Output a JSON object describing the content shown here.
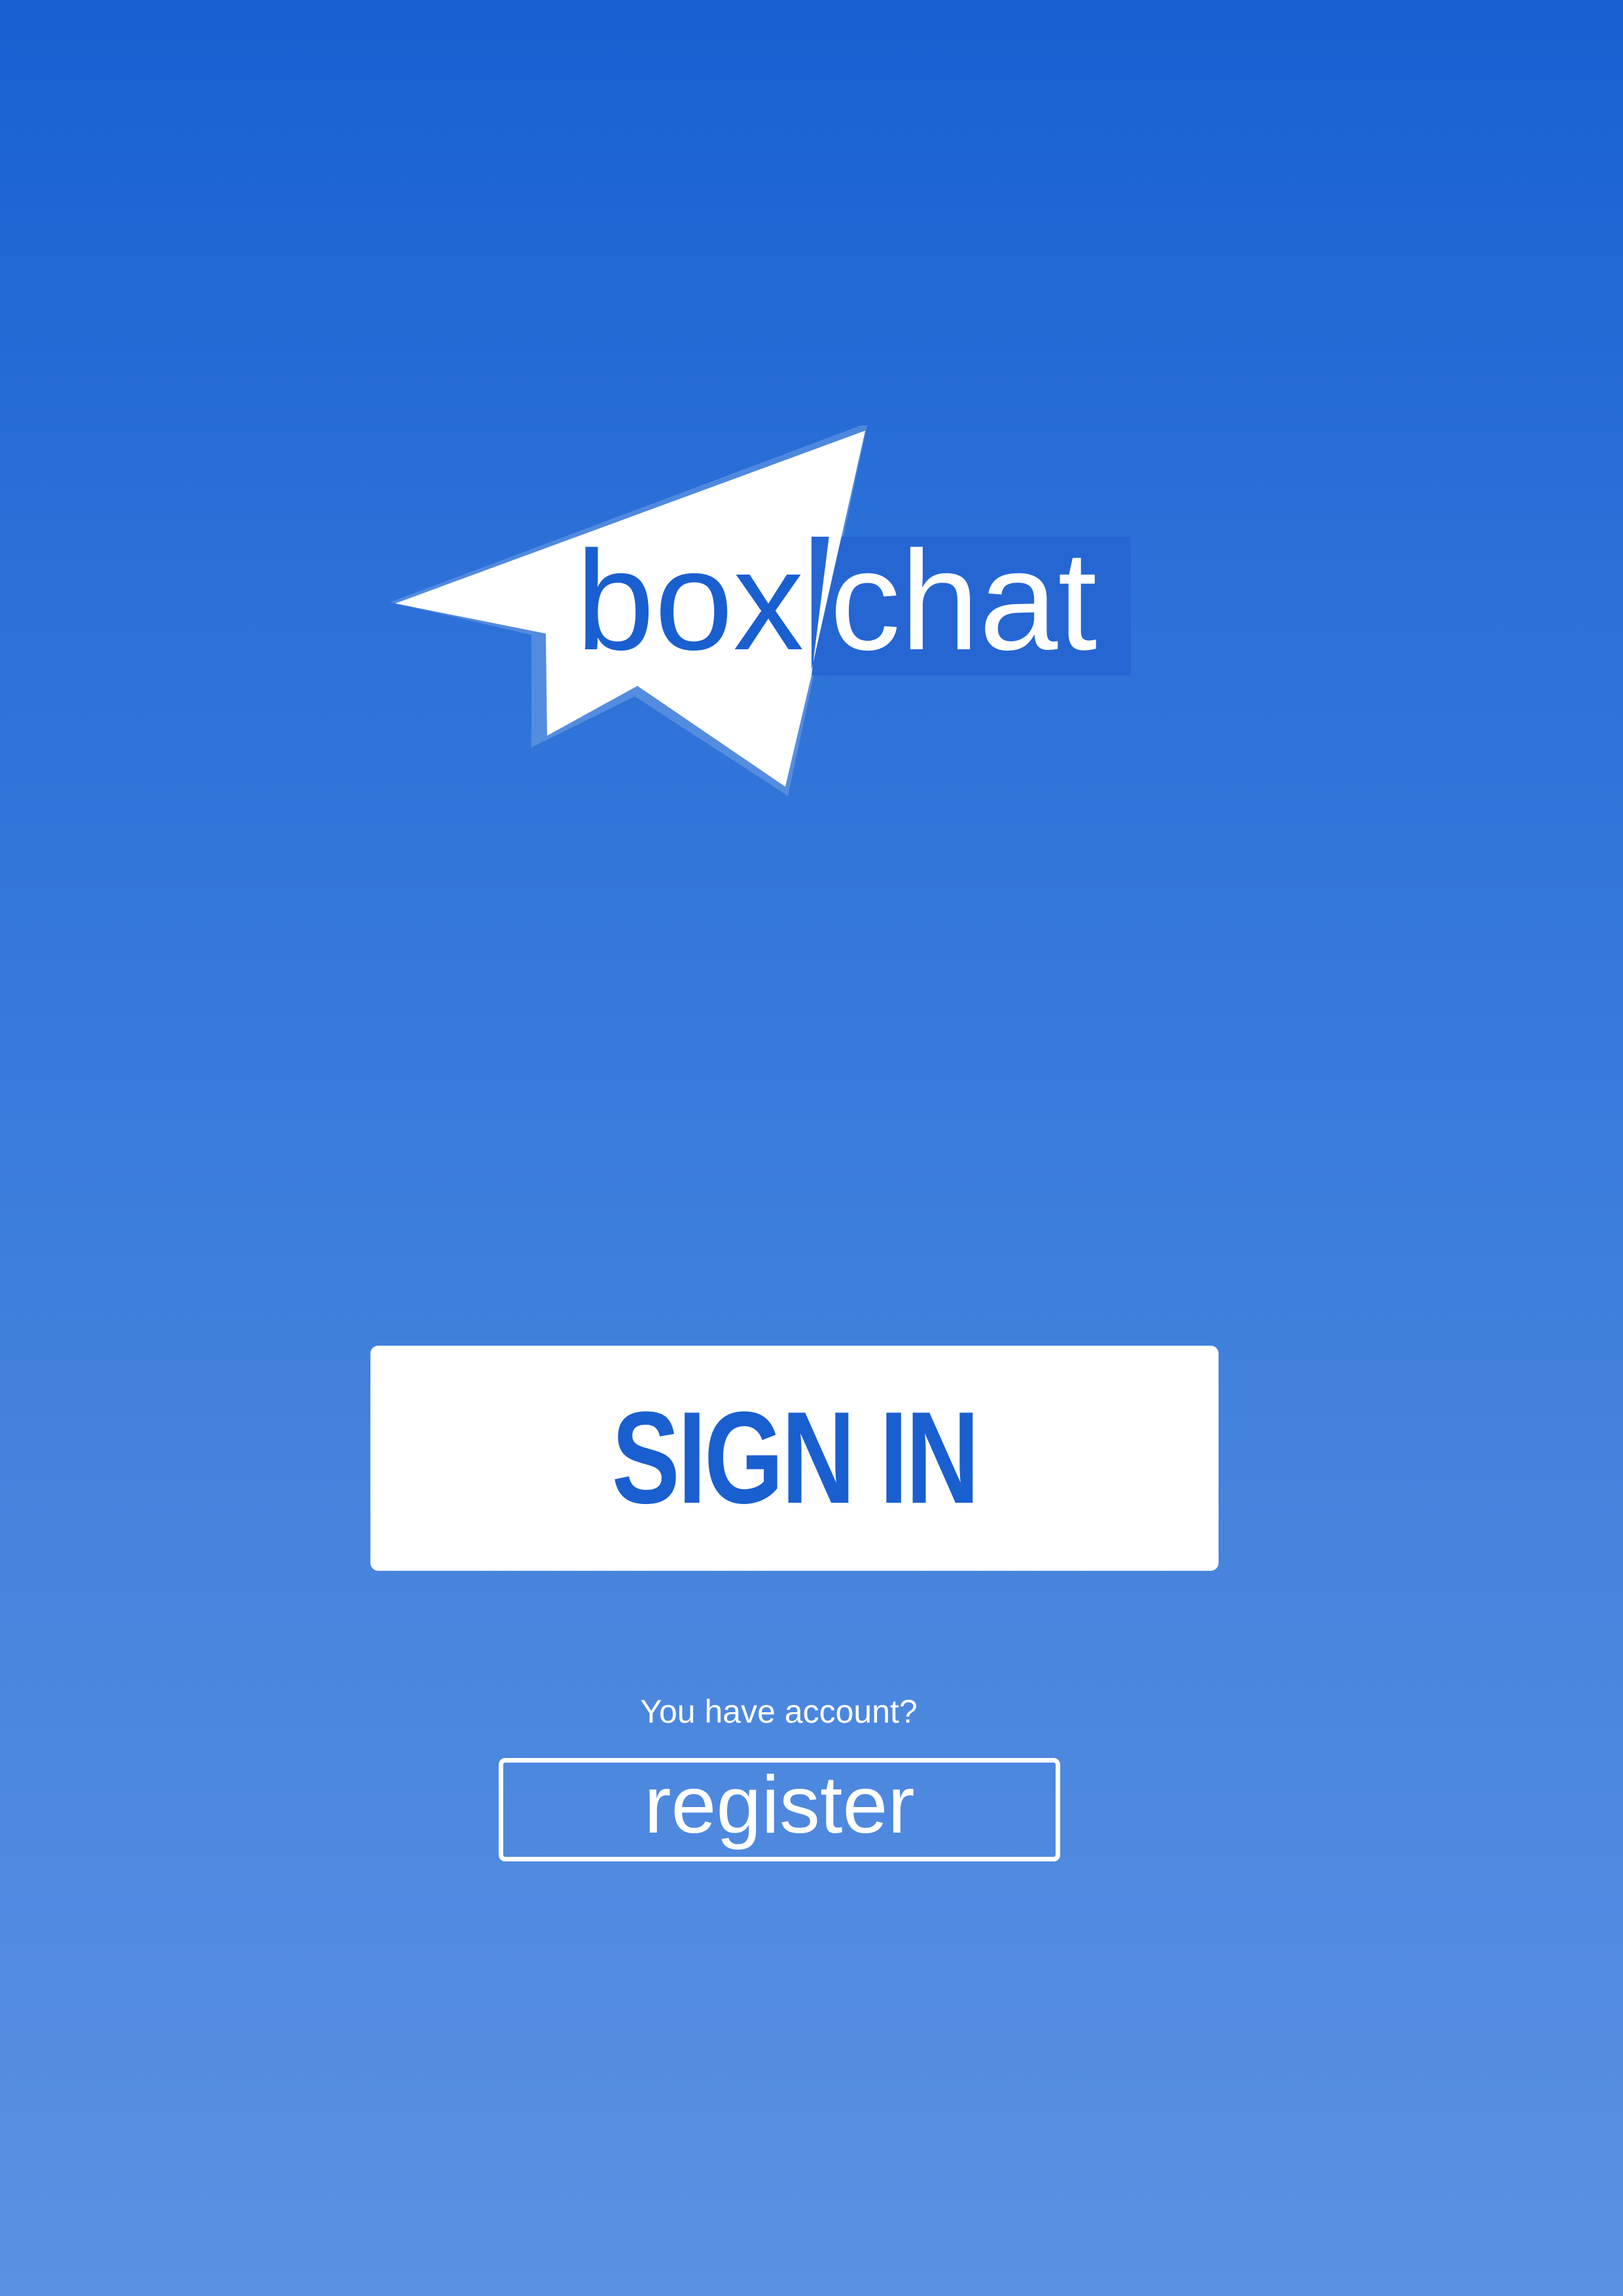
{
  "logo": {
    "word_left": "box",
    "word_right": "chat",
    "icon": "paper-plane-icon"
  },
  "auth": {
    "signin_label": "SIGN IN",
    "account_prompt": "You have account?",
    "register_label": "register"
  },
  "colors": {
    "gradient_top": "#1860d2",
    "gradient_bottom": "#5a91e2",
    "button_fill": "#ffffff",
    "brand_blue": "#1a5fd0",
    "text_light": "#ffffff"
  }
}
